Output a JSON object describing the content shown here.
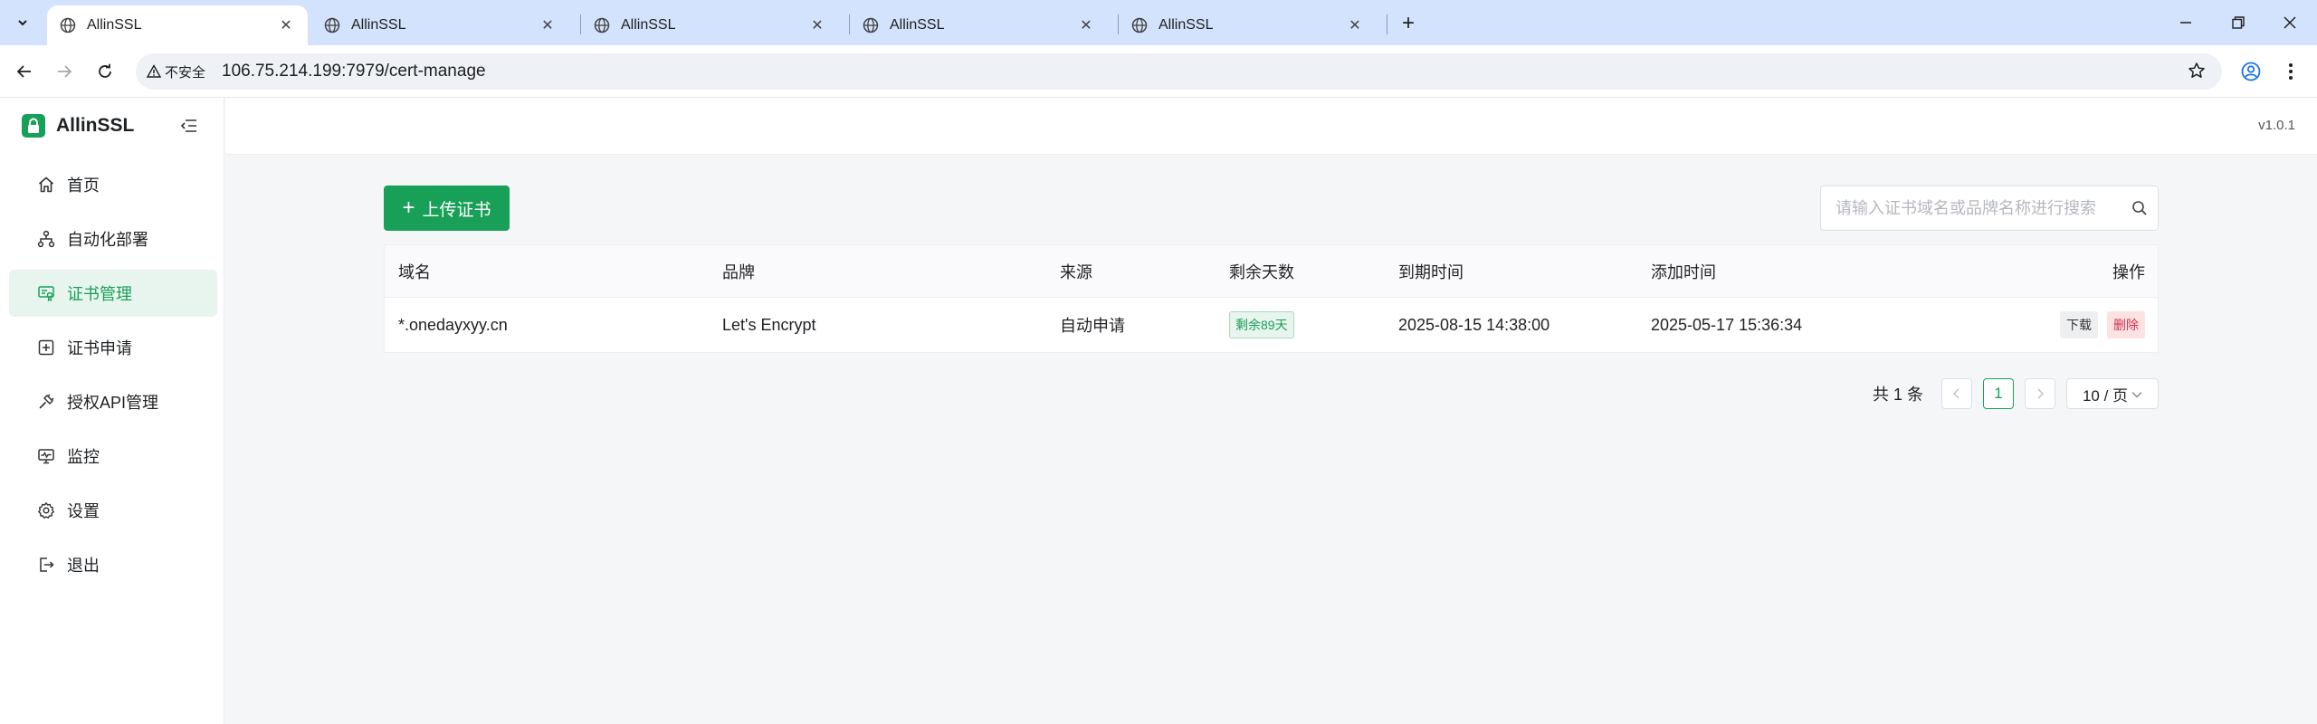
{
  "browser": {
    "tabs": [
      {
        "title": "AllinSSL",
        "active": true
      },
      {
        "title": "AllinSSL",
        "active": false
      },
      {
        "title": "AllinSSL",
        "active": false
      },
      {
        "title": "AllinSSL",
        "active": false
      },
      {
        "title": "AllinSSL",
        "active": false
      }
    ],
    "security_label": "不安全",
    "url": "106.75.214.199:7979/cert-manage"
  },
  "app": {
    "name": "AllinSSL",
    "version": "v1.0.1",
    "accent_color": "#18a058"
  },
  "sidebar": {
    "items": [
      {
        "label": "首页",
        "icon": "home-icon",
        "active": false
      },
      {
        "label": "自动化部署",
        "icon": "workflow-icon",
        "active": false
      },
      {
        "label": "证书管理",
        "icon": "certificate-icon",
        "active": true
      },
      {
        "label": "证书申请",
        "icon": "add-square-icon",
        "active": false
      },
      {
        "label": "授权API管理",
        "icon": "api-plug-icon",
        "active": false
      },
      {
        "label": "监控",
        "icon": "monitor-icon",
        "active": false
      },
      {
        "label": "设置",
        "icon": "gear-icon",
        "active": false
      },
      {
        "label": "退出",
        "icon": "logout-icon",
        "active": false
      }
    ]
  },
  "toolbar": {
    "upload_label": "上传证书",
    "search_placeholder": "请输入证书域名或品牌名称进行搜索"
  },
  "table": {
    "columns": [
      "域名",
      "品牌",
      "来源",
      "剩余天数",
      "到期时间",
      "添加时间",
      "操作"
    ],
    "rows": [
      {
        "domain": "*.onedayxyy.cn",
        "brand": "Let's Encrypt",
        "source": "自动申请",
        "remaining": "剩余89天",
        "expires": "2025-08-15 14:38:00",
        "added": "2025-05-17 15:36:34",
        "actions": {
          "download": "下载",
          "delete": "删除"
        }
      }
    ]
  },
  "pagination": {
    "total_text": "共 1 条",
    "current_page": "1",
    "page_size": "10 / 页"
  }
}
